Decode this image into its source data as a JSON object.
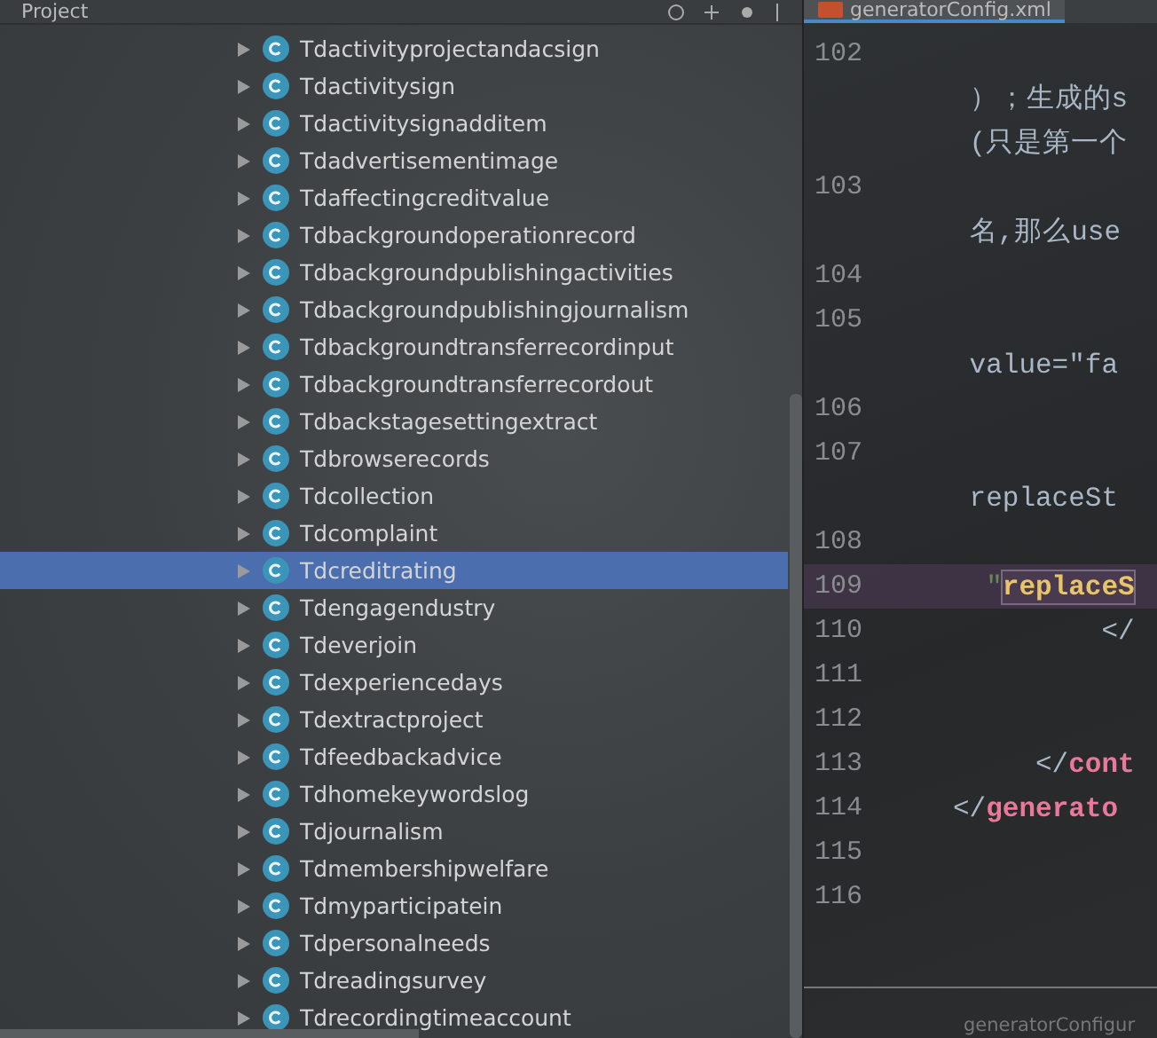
{
  "project_panel": {
    "title": "Project",
    "items": [
      {
        "label": "Tdactivityprojectandacsign",
        "selected": false
      },
      {
        "label": "Tdactivitysign",
        "selected": false
      },
      {
        "label": "Tdactivitysignadditem",
        "selected": false
      },
      {
        "label": "Tdadvertisementimage",
        "selected": false
      },
      {
        "label": "Tdaffectingcreditvalue",
        "selected": false
      },
      {
        "label": "Tdbackgroundoperationrecord",
        "selected": false
      },
      {
        "label": "Tdbackgroundpublishingactivities",
        "selected": false
      },
      {
        "label": "Tdbackgroundpublishingjournalism",
        "selected": false
      },
      {
        "label": "Tdbackgroundtransferrecordinput",
        "selected": false
      },
      {
        "label": "Tdbackgroundtransferrecordout",
        "selected": false
      },
      {
        "label": "Tdbackstagesettingextract",
        "selected": false
      },
      {
        "label": "Tdbrowserecords",
        "selected": false
      },
      {
        "label": "Tdcollection",
        "selected": false
      },
      {
        "label": "Tdcomplaint",
        "selected": false
      },
      {
        "label": "Tdcreditrating",
        "selected": true
      },
      {
        "label": "Tdengagendustry",
        "selected": false
      },
      {
        "label": "Tdeverjoin",
        "selected": false
      },
      {
        "label": "Tdexperiencedays",
        "selected": false
      },
      {
        "label": "Tdextractproject",
        "selected": false
      },
      {
        "label": "Tdfeedbackadvice",
        "selected": false
      },
      {
        "label": "Tdhomekeywordslog",
        "selected": false
      },
      {
        "label": "Tdjournalism",
        "selected": false
      },
      {
        "label": "Tdmembershipwelfare",
        "selected": false
      },
      {
        "label": "Tdmyparticipatein",
        "selected": false
      },
      {
        "label": "Tdpersonalneeds",
        "selected": false
      },
      {
        "label": "Tdreadingsurvey",
        "selected": false
      },
      {
        "label": "Tdrecordingtimeaccount",
        "selected": false
      }
    ]
  },
  "editor": {
    "tab": "generatorConfig.xml",
    "rows": [
      {
        "number": "102",
        "current": false,
        "tokens": []
      },
      {
        "current": false,
        "tokens": [
          {
            "kind": "text",
            "text": " ）；生成的s"
          }
        ]
      },
      {
        "current": false,
        "tokens": [
          {
            "kind": "text",
            "text": " (只是第一个"
          }
        ]
      },
      {
        "number": "103",
        "current": false,
        "tokens": []
      },
      {
        "current": false,
        "tokens": [
          {
            "kind": "text",
            "text": " 名,那么use"
          }
        ]
      },
      {
        "number": "104",
        "current": false,
        "tokens": []
      },
      {
        "number": "105",
        "current": false,
        "tokens": []
      },
      {
        "current": false,
        "tokens": [
          {
            "kind": "text",
            "text": " value=\"fa"
          }
        ]
      },
      {
        "number": "106",
        "current": false,
        "tokens": []
      },
      {
        "number": "107",
        "current": false,
        "tokens": []
      },
      {
        "current": false,
        "tokens": [
          {
            "kind": "text",
            "text": " replaceSt"
          }
        ]
      },
      {
        "number": "108",
        "current": false,
        "tokens": []
      },
      {
        "number": "109",
        "current": true,
        "tokens": [
          {
            "kind": "string",
            "text": "  \""
          },
          {
            "kind": "attr",
            "text": "replaceS"
          }
        ]
      },
      {
        "number": "110",
        "current": false,
        "tokens": [
          {
            "kind": "text",
            "text": "         </"
          }
        ]
      },
      {
        "number": "111",
        "current": false,
        "tokens": []
      },
      {
        "number": "112",
        "current": false,
        "tokens": []
      },
      {
        "number": "113",
        "current": false,
        "tokens": [
          {
            "kind": "text",
            "text": "     </"
          },
          {
            "kind": "tag",
            "text": "cont"
          }
        ]
      },
      {
        "number": "114",
        "current": false,
        "tokens": [
          {
            "kind": "text",
            "text": "</"
          },
          {
            "kind": "tag",
            "text": "generato"
          }
        ]
      },
      {
        "number": "115",
        "current": false,
        "tokens": []
      },
      {
        "number": "116",
        "current": false,
        "tokens": []
      }
    ]
  },
  "status_bar": {
    "breadcrumb": "generatorConfigur"
  }
}
